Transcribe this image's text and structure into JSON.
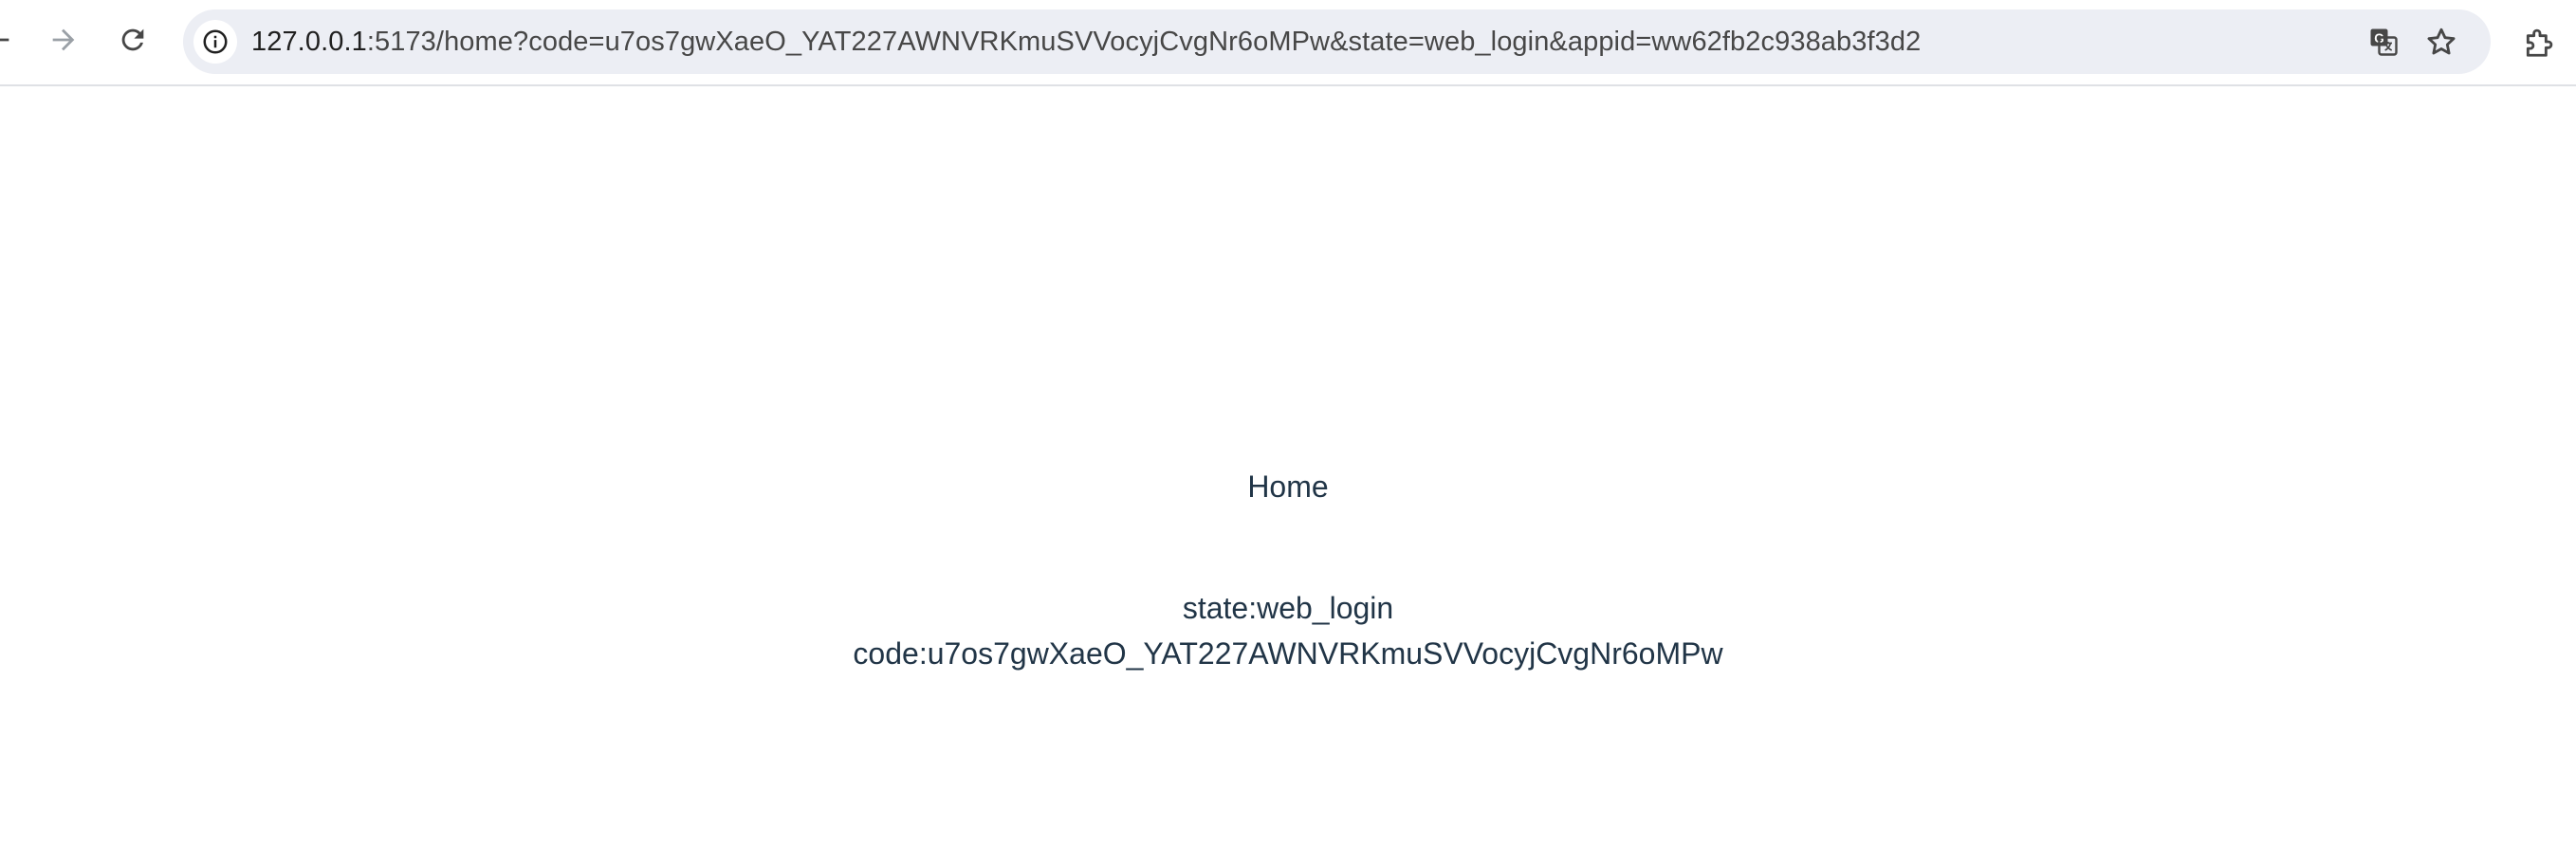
{
  "browser": {
    "url_host": "127.0.0.1",
    "url_rest": ":5173/home?code=u7os7gwXaeO_YAT227AWNVRKmuSVVocyjCvgNr6oMPw&state=web_login&appid=ww62fb2c938ab3f3d2",
    "icons": {
      "back": "arrow-left-icon",
      "forward": "arrow-right-icon",
      "reload": "reload-icon",
      "site_info": "info-icon",
      "translate": "translate-icon",
      "bookmark": "star-icon",
      "extensions": "puzzle-icon"
    }
  },
  "page": {
    "title": "Home",
    "state_text": "state:web_login",
    "code_text": "code:u7os7gwXaeO_YAT227AWNVRKmuSVVocyjCvgNr6oMPw"
  },
  "colors": {
    "toolbar_bg": "#ffffff",
    "omnibox_bg": "#eceef4",
    "page_text": "#213547",
    "icon": "#474747"
  }
}
